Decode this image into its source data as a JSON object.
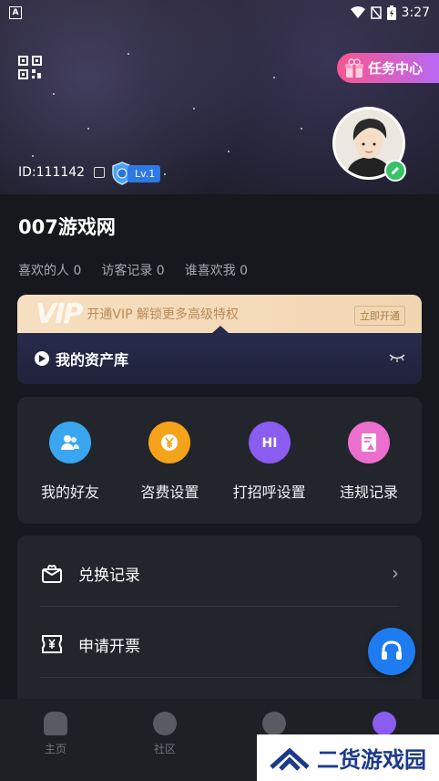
{
  "status_bar": {
    "time": "3:27"
  },
  "header": {
    "task_center": "任务中心",
    "user_id": "ID:111142",
    "level": "Lv.1"
  },
  "profile": {
    "username": "007游戏网",
    "stats": [
      "喜欢的人 0",
      "访客记录 0",
      "谁喜欢我 0"
    ]
  },
  "vip": {
    "logo": "VIP",
    "promo": "开通VIP 解锁更多高级特权",
    "open_label": "立即开通",
    "assets_label": "我的资产库"
  },
  "tools": [
    {
      "label": "我的好友",
      "color": "#3aa6f0",
      "icon": "friends-icon"
    },
    {
      "label": "咨费设置",
      "color": "#f5a31a",
      "icon": "yuan-icon"
    },
    {
      "label": "打招呼设置",
      "color": "#8b5cf0",
      "icon": "hi-icon"
    },
    {
      "label": "违规记录",
      "color": "#ec6fcf",
      "icon": "report-icon"
    }
  ],
  "menu": [
    {
      "label": "兑换记录"
    },
    {
      "label": "申请开票"
    }
  ],
  "tabbar": [
    {
      "label": "主页"
    },
    {
      "label": "社区"
    }
  ],
  "watermark": "二货游戏园"
}
